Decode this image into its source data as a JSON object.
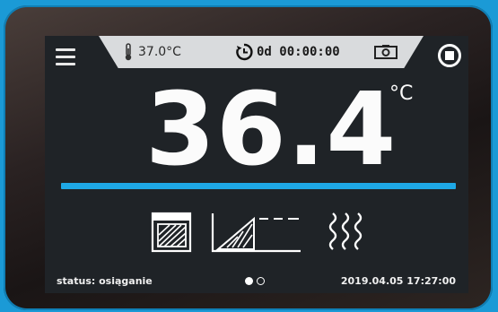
{
  "top_bar": {
    "setpoint": "37.0°C",
    "timer": "0d 00:00:00"
  },
  "main": {
    "temperature": "36.4",
    "unit": "°C"
  },
  "footer": {
    "status": "status: osiąganie",
    "datetime": "2019.04.05  17:27:00",
    "page_count": 2,
    "active_page": 1
  },
  "icons": [
    "menu-icon",
    "thermometer-icon",
    "timer-icon",
    "camera-icon",
    "stop-icon",
    "chamber-icon",
    "ramp-icon",
    "heating-icon"
  ],
  "colors": {
    "accent": "#1ea8e6",
    "screen": "#1f2327",
    "bar": "#d9dbdd"
  }
}
